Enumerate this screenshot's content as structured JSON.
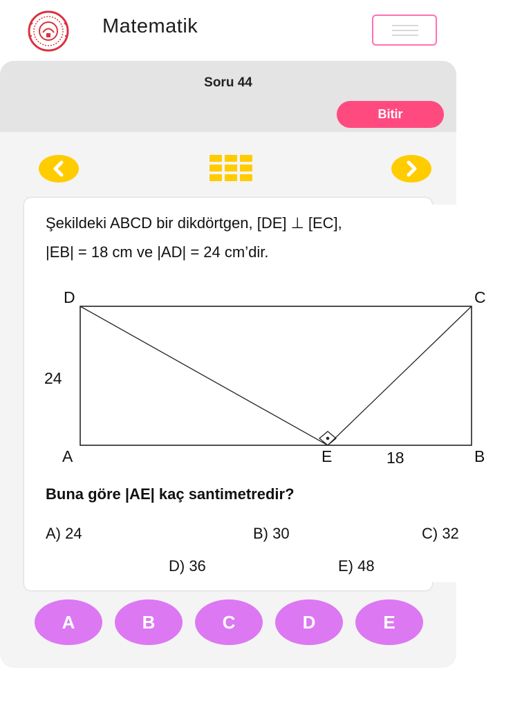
{
  "header": {
    "title": "Matematik",
    "logo_icon": "meb-seal-logo",
    "menu_icon": "hamburger-menu-icon"
  },
  "toolbar": {
    "question_number": "Soru 44",
    "finish_label": "Bitir",
    "prev_icon": "chevron-left-icon",
    "grid_icon": "question-grid-icon",
    "next_icon": "chevron-right-icon"
  },
  "question": {
    "line1": "Şekildeki ABCD bir dikdörtgen, [DE] ⊥ [EC],",
    "line2": "|EB| = 18 cm ve |AD| = 24 cm’dir.",
    "figure": {
      "vertices": {
        "D": "D",
        "C": "C",
        "A": "A",
        "B": "B",
        "E": "E"
      },
      "side_ad": "24",
      "side_eb": "18"
    },
    "ask": "Buna göre |AE| kaç santimetredir?",
    "options": [
      {
        "text": "A) 24"
      },
      {
        "text": "B) 30"
      },
      {
        "text": "C) 32"
      },
      {
        "text": "D) 36"
      },
      {
        "text": "E) 48"
      }
    ]
  },
  "answers": [
    "A",
    "B",
    "C",
    "D",
    "E"
  ],
  "colors": {
    "accent_yellow": "#ffcc00",
    "finish_pink": "#ff4a80",
    "answer_purple": "#dc78f2",
    "menu_border": "#ff6fb3",
    "logo_red": "#d9333f"
  }
}
